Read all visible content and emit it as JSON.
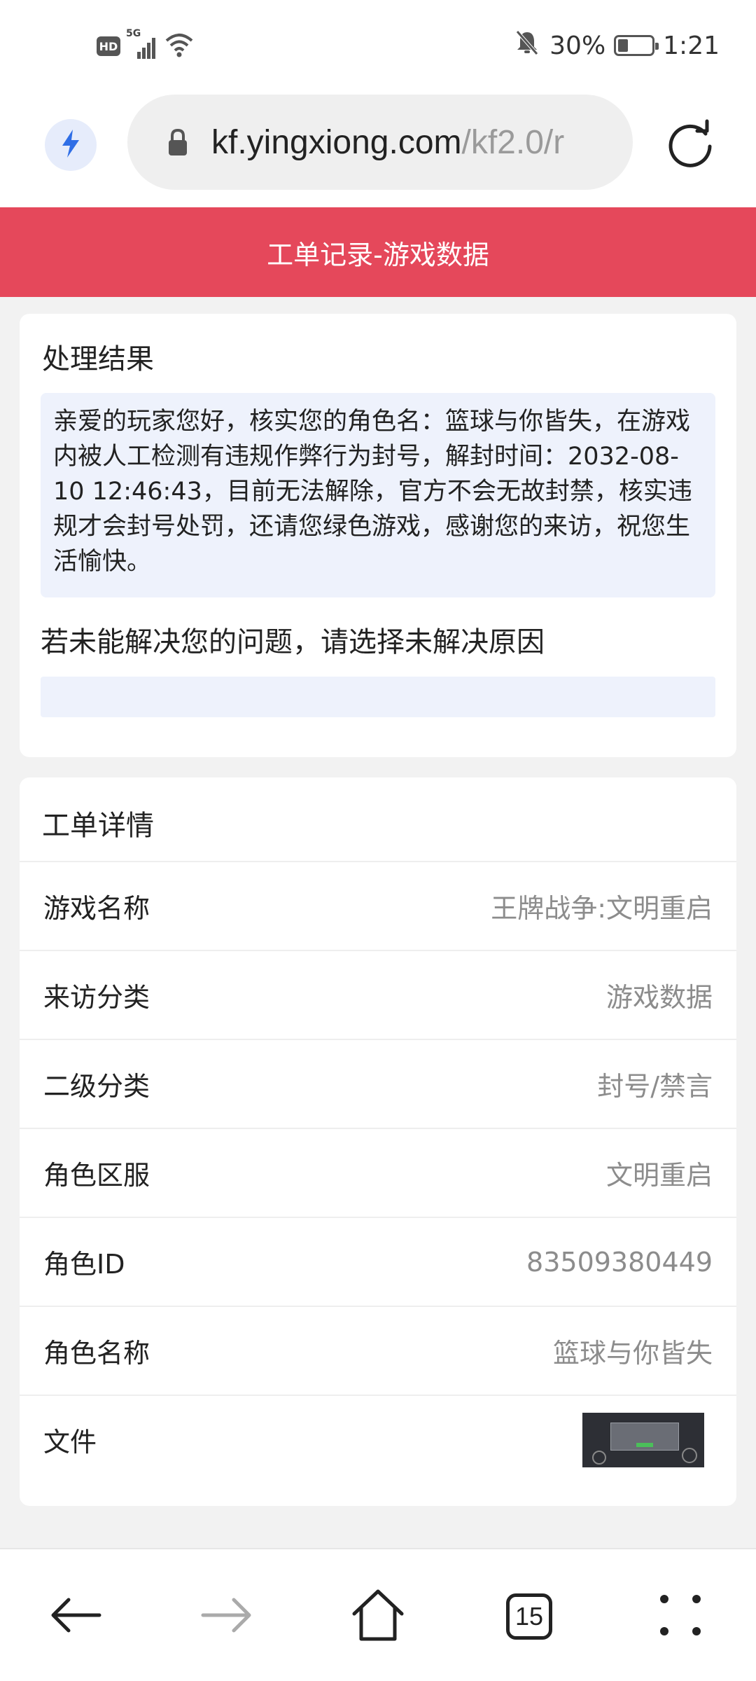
{
  "status_bar": {
    "hd_label": "HD",
    "network_label": "5G",
    "battery_text": "30%",
    "battery_level": 0.3,
    "time": "1:21",
    "icons": [
      "hd-icon",
      "signal-icon",
      "wifi-icon",
      "mute-bell-icon",
      "battery-icon"
    ]
  },
  "browser": {
    "url_domain": "kf.yingxiong.com",
    "url_path": "/kf2.0/r",
    "icons": [
      "flash-icon",
      "lock-icon",
      "reload-icon"
    ]
  },
  "header": {
    "title": "工单记录-游戏数据"
  },
  "result": {
    "title": "处理结果",
    "message": "亲爱的玩家您好，核实您的角色名：篮球与你皆失，在游戏内被人工检测有违规作弊行为封号，解封时间：2032-08-10 12:46:43，目前无法解除，官方不会无故封禁，核实违规才会封号处罚，还请您绿色游戏，感谢您的来访，祝您生活愉快。",
    "unresolved_prompt": "若未能解决您的问题，请选择未解决原因",
    "reason_value": ""
  },
  "detail": {
    "title": "工单详情",
    "rows": [
      {
        "label": "游戏名称",
        "value": "王牌战争:文明重启"
      },
      {
        "label": "来访分类",
        "value": "游戏数据"
      },
      {
        "label": "二级分类",
        "value": "封号/禁言"
      },
      {
        "label": "角色区服",
        "value": "文明重启"
      },
      {
        "label": "角色ID",
        "value": "83509380449"
      },
      {
        "label": "角色名称",
        "value": "篮球与你皆失"
      },
      {
        "label": "文件",
        "value": ""
      }
    ]
  },
  "bottom_nav": {
    "tabs_count": "15",
    "icons": [
      "back-arrow-icon",
      "forward-arrow-icon",
      "home-icon",
      "tabs-icon",
      "menu-dots-icon"
    ]
  },
  "colors": {
    "header_bg": "#e5485b",
    "accent_blue": "#2f6ee6",
    "result_box_bg": "#eef2fc",
    "value_gray": "#8c8c8c"
  }
}
